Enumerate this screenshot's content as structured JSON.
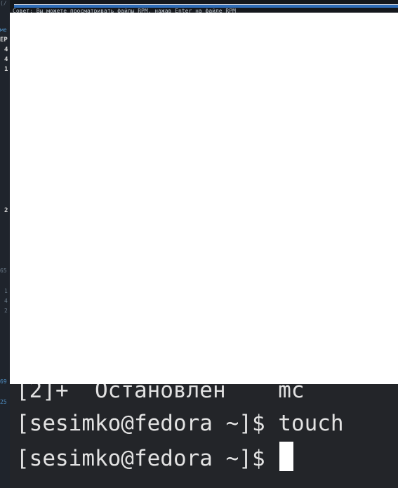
{
  "status_hint": "Совет: Вы можете просматривать файлы RPM, нажав Enter на файле RPM",
  "left_fragments": {
    "f1": "(/",
    "f2": "ме",
    "f3": "EP",
    "f4": "4",
    "f5": "4",
    "f6": "1",
    "f7": "2",
    "f8": "65",
    "f9": "1",
    "f10": "4",
    "f11": "2",
    "f12": "69",
    "f13": "25"
  },
  "terminal": {
    "job_line": "[2]+  Остановлен    mc",
    "prompt": "[sesimko@fedora ~]$ ",
    "command": "touch",
    "prompt2": "[sesimko@fedora ~]$ "
  }
}
